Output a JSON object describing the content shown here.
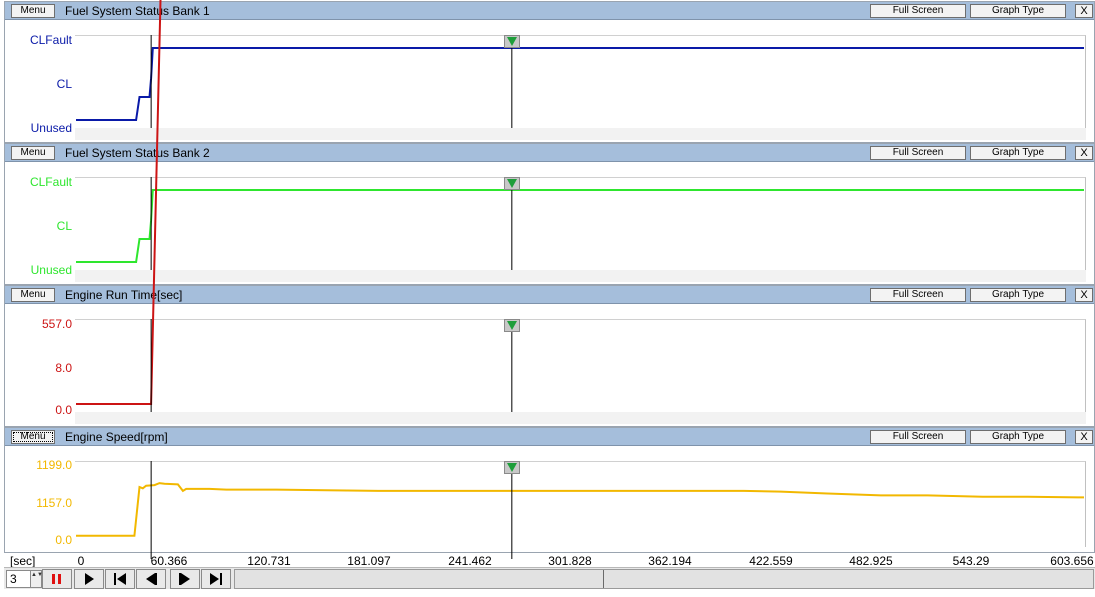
{
  "panels": [
    {
      "menu_label": "Menu",
      "title": "Fuel System Status Bank 1",
      "full_screen_label": "Full Screen",
      "graph_type_label": "Graph Type",
      "close_label": "X",
      "color": "#0a1aa8",
      "y_labels": [
        "CLFault",
        "CL",
        "Unused"
      ]
    },
    {
      "menu_label": "Menu",
      "title": "Fuel System Status Bank 2",
      "full_screen_label": "Full Screen",
      "graph_type_label": "Graph Type",
      "close_label": "X",
      "color": "#2ee62e",
      "y_labels": [
        "CLFault",
        "CL",
        "Unused"
      ]
    },
    {
      "menu_label": "Menu",
      "title": "Engine Run Time[sec]",
      "full_screen_label": "Full Screen",
      "graph_type_label": "Graph Type",
      "close_label": "X",
      "color": "#cc1414",
      "y_labels": [
        "557.0",
        "8.0",
        "0.0"
      ]
    },
    {
      "menu_label": "Menu",
      "title": "Engine Speed[rpm]",
      "full_screen_label": "Full Screen",
      "graph_type_label": "Graph Type",
      "close_label": "X",
      "color": "#f2b800",
      "y_labels": [
        "1199.0",
        "1157.0",
        "0.0"
      ]
    }
  ],
  "x_axis": {
    "unit": "[sec]",
    "ticks": [
      "0",
      "60.366",
      "120.731",
      "181.097",
      "241.462",
      "301.828",
      "362.194",
      "422.559",
      "482.925",
      "543.29",
      "603.656"
    ]
  },
  "toolbar": {
    "speed_value": "3",
    "spin_arrows": "▲▼"
  },
  "chart_data": [
    {
      "type": "line",
      "title": "Fuel System Status Bank 1",
      "xlim": [
        0,
        603.656
      ],
      "y_categories": [
        "Unused",
        "CL",
        "CLFault"
      ],
      "series": [
        {
          "x": [
            0,
            36,
            38,
            44,
            45,
            46,
            603.656
          ],
          "y": [
            0,
            0,
            0.32,
            0.32,
            0.58,
            1,
            1
          ]
        }
      ],
      "cursors_x": [
        45,
        261
      ]
    },
    {
      "type": "line",
      "title": "Fuel System Status Bank 2",
      "xlim": [
        0,
        603.656
      ],
      "y_categories": [
        "Unused",
        "CL",
        "CLFault"
      ],
      "series": [
        {
          "x": [
            0,
            36,
            38,
            44,
            45,
            46,
            603.656
          ],
          "y": [
            0,
            0,
            0.32,
            0.32,
            0.58,
            1,
            1
          ]
        }
      ],
      "cursors_x": [
        45,
        261
      ]
    },
    {
      "type": "line",
      "title": "Engine Run Time[sec]",
      "xlim": [
        0,
        603.656
      ],
      "y_ticks": [
        "0.0",
        "8.0",
        "557.0"
      ],
      "series": [
        {
          "x": [
            0,
            45,
            603.656
          ],
          "y": [
            0,
            0,
            557
          ]
        }
      ],
      "cursors_x": [
        45,
        261
      ]
    },
    {
      "type": "line",
      "title": "Engine Speed[rpm]",
      "xlim": [
        0,
        603.656
      ],
      "y_ticks": [
        "0.0",
        "1157.0",
        "1199.0"
      ],
      "series": [
        {
          "x": [
            0,
            35,
            38,
            40,
            42,
            47,
            50,
            53,
            61,
            64,
            66,
            80,
            90,
            120,
            150,
            181,
            200,
            241,
            261,
            300,
            362,
            400,
            422,
            450,
            482,
            510,
            543,
            570,
            600,
            603.656
          ],
          "y": [
            0.05,
            0.05,
            0.8,
            0.78,
            0.82,
            0.83,
            0.86,
            0.85,
            0.84,
            0.74,
            0.77,
            0.77,
            0.76,
            0.76,
            0.75,
            0.74,
            0.74,
            0.74,
            0.74,
            0.74,
            0.74,
            0.74,
            0.73,
            0.7,
            0.67,
            0.67,
            0.65,
            0.65,
            0.64,
            0.64
          ]
        }
      ],
      "cursors_x": [
        45,
        261
      ]
    }
  ]
}
